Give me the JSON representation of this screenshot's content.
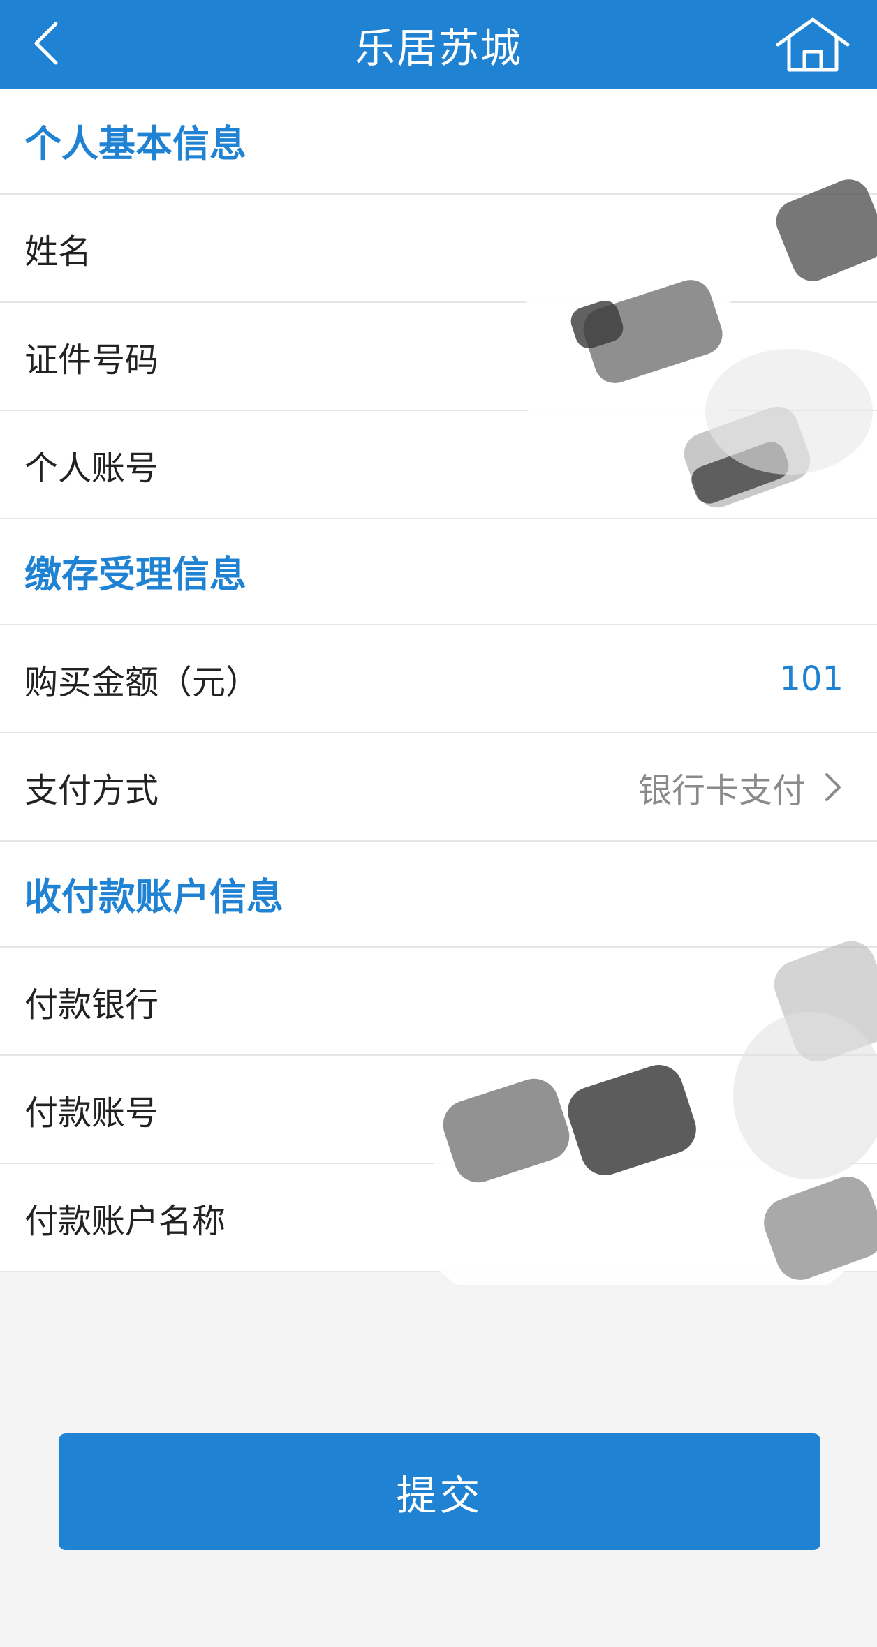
{
  "header": {
    "title": "乐居苏城",
    "back_icon": "chevron-left-icon",
    "home_icon": "home-icon"
  },
  "sections": {
    "personal": {
      "title": "个人基本信息",
      "name_label": "姓名",
      "id_label": "证件号码",
      "account_label": "个人账号"
    },
    "deposit": {
      "title": "缴存受理信息",
      "amount_label": "购买金额（元）",
      "amount_value": "101",
      "payment_label": "支付方式",
      "payment_value": "银行卡支付"
    },
    "payee": {
      "title": "收付款账户信息",
      "bank_label": "付款银行",
      "account_label": "付款账号",
      "account_name_label": "付款账户名称"
    }
  },
  "submit_label": "提交",
  "colors": {
    "brand": "#1f82d3",
    "background": "#f4f4f4",
    "value_gray": "#8a8a8a"
  }
}
